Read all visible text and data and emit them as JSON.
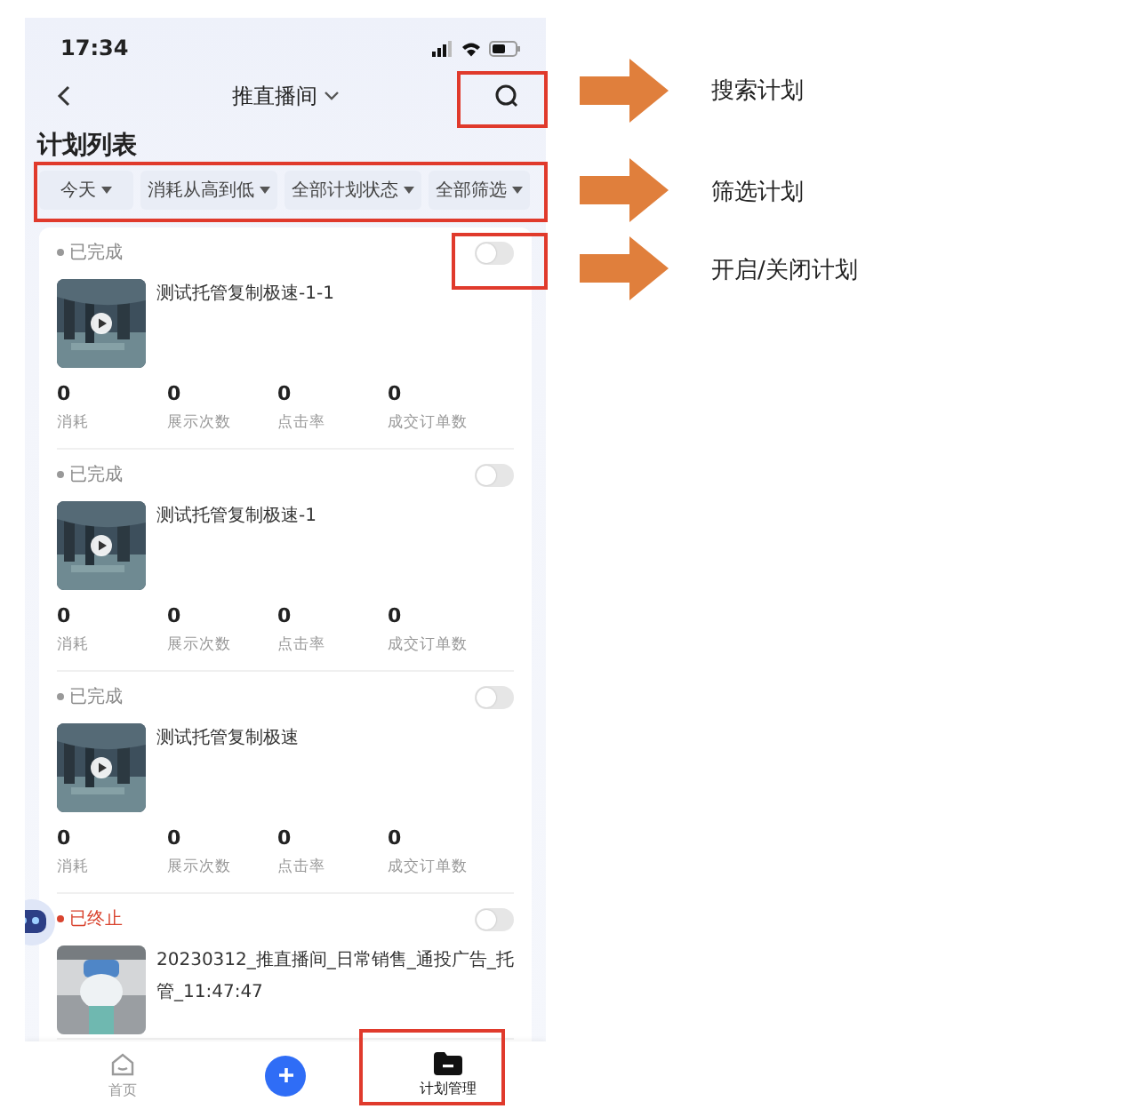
{
  "status_bar": {
    "time": "17:34"
  },
  "nav": {
    "title": "推直播间"
  },
  "heading": "计划列表",
  "filters": [
    {
      "label": "今天"
    },
    {
      "label": "消耗从高到低"
    },
    {
      "label": "全部计划状态"
    },
    {
      "label": "全部筛选"
    }
  ],
  "plans": [
    {
      "status": "已完成",
      "color": "#999999",
      "on": false,
      "title": "测试托管复制极速-1-1",
      "video": true,
      "stats": [
        {
          "value": "0",
          "label": "消耗"
        },
        {
          "value": "0",
          "label": "展示次数"
        },
        {
          "value": "0",
          "label": "点击率"
        },
        {
          "value": "0",
          "label": "成交订单数"
        }
      ]
    },
    {
      "status": "已完成",
      "color": "#999999",
      "on": false,
      "title": "测试托管复制极速-1",
      "video": true,
      "stats": [
        {
          "value": "0",
          "label": "消耗"
        },
        {
          "value": "0",
          "label": "展示次数"
        },
        {
          "value": "0",
          "label": "点击率"
        },
        {
          "value": "0",
          "label": "成交订单数"
        }
      ]
    },
    {
      "status": "已完成",
      "color": "#999999",
      "on": false,
      "title": "测试托管复制极速",
      "video": true,
      "stats": [
        {
          "value": "0",
          "label": "消耗"
        },
        {
          "value": "0",
          "label": "展示次数"
        },
        {
          "value": "0",
          "label": "点击率"
        },
        {
          "value": "0",
          "label": "成交订单数"
        }
      ]
    },
    {
      "status": "已终止",
      "color": "#d9442f",
      "on": false,
      "title": "20230312_推直播间_日常销售_通投广告_托管_11:47:47",
      "video": false
    }
  ],
  "tab_bar": [
    {
      "kind": "home",
      "label": "首页",
      "selected": false
    },
    {
      "kind": "add"
    },
    {
      "kind": "folder",
      "label": "计划管理",
      "selected": true
    }
  ],
  "annotations": [
    {
      "label": "搜索计划"
    },
    {
      "label": "筛选计划"
    },
    {
      "label": "开启/关闭计划"
    }
  ]
}
